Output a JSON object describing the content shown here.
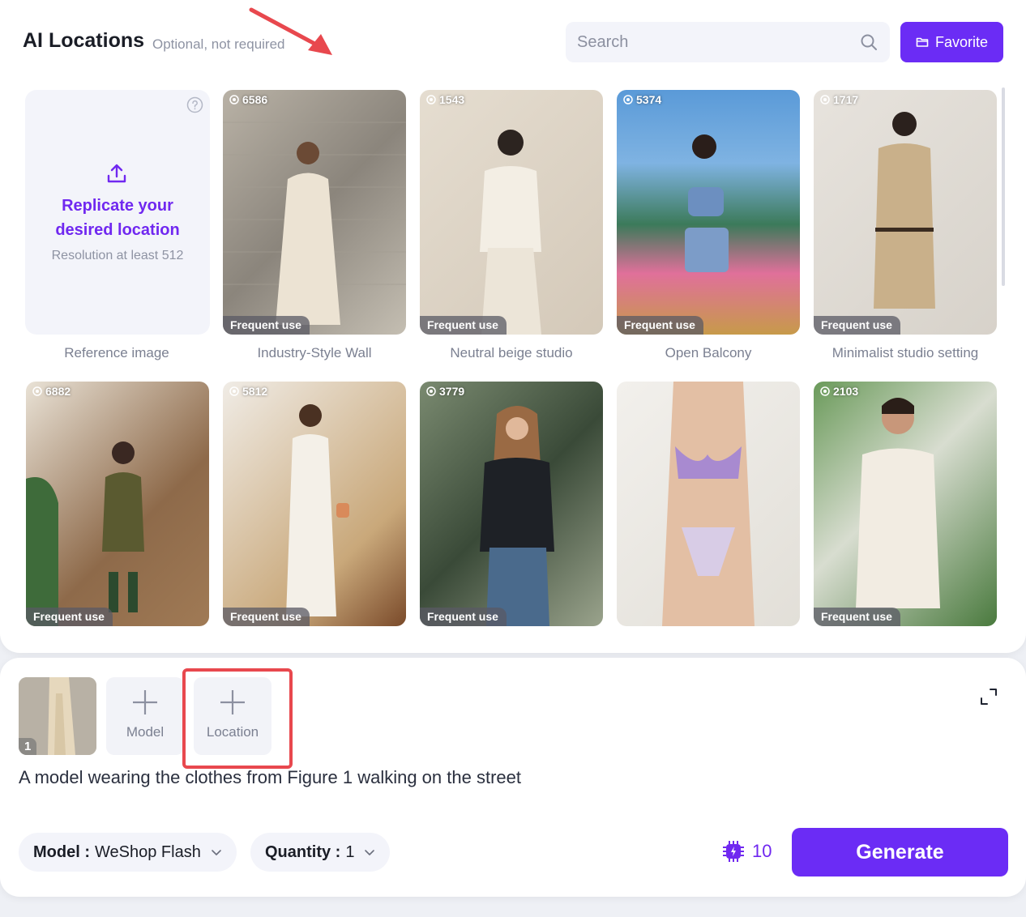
{
  "header": {
    "title": "AI Locations",
    "subtitle": "Optional, not required"
  },
  "search": {
    "placeholder": "Search"
  },
  "favorite_label": "Favorite",
  "reference": {
    "title": "Replicate your\ndesired location",
    "resolution": "Resolution at least 512",
    "label": "Reference image"
  },
  "locations": [
    {
      "count": "6586",
      "tag": "Frequent use",
      "label": "Industry-Style Wall"
    },
    {
      "count": "1543",
      "tag": "Frequent use",
      "label": "Neutral beige studio"
    },
    {
      "count": "5374",
      "tag": "Frequent use",
      "label": "Open Balcony"
    },
    {
      "count": "1717",
      "tag": "Frequent use",
      "label": "Minimalist studio setting"
    },
    {
      "count": "6882",
      "tag": "Frequent use",
      "label": ""
    },
    {
      "count": "5812",
      "tag": "Frequent use",
      "label": ""
    },
    {
      "count": "3779",
      "tag": "Frequent use",
      "label": ""
    },
    {
      "count": "",
      "tag": "",
      "label": ""
    },
    {
      "count": "2103",
      "tag": "Frequent use",
      "label": ""
    }
  ],
  "composer": {
    "thumb_number": "1",
    "add_model": "Model",
    "add_location": "Location",
    "prompt": "A model wearing the clothes from Figure 1 walking on the street"
  },
  "options": {
    "model_key": "Model :",
    "model_value": "WeShop Flash",
    "quantity_key": "Quantity :",
    "quantity_value": "1"
  },
  "credits": "10",
  "generate_label": "Generate",
  "colors": {
    "accent": "#6b2cf5",
    "annotation": "#e8484e"
  }
}
